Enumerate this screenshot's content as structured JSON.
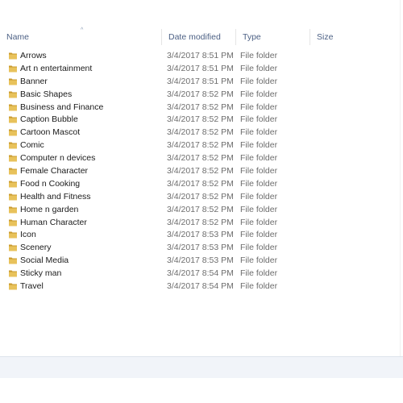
{
  "columns": {
    "name": "Name",
    "date_modified": "Date modified",
    "type": "Type",
    "size": "Size"
  },
  "sort_indicator": "^",
  "folder_icon": "folder-icon",
  "colors": {
    "folder": "#e8c25b",
    "folder_dark": "#c99a2e",
    "header_text": "#4d6185"
  },
  "items": [
    {
      "name": "Arrows",
      "date": "3/4/2017 8:51 PM",
      "type": "File folder"
    },
    {
      "name": "Art n entertainment",
      "date": "3/4/2017 8:51 PM",
      "type": "File folder"
    },
    {
      "name": "Banner",
      "date": "3/4/2017 8:51 PM",
      "type": "File folder"
    },
    {
      "name": "Basic Shapes",
      "date": "3/4/2017 8:52 PM",
      "type": "File folder"
    },
    {
      "name": "Business and Finance",
      "date": "3/4/2017 8:52 PM",
      "type": "File folder"
    },
    {
      "name": "Caption Bubble",
      "date": "3/4/2017 8:52 PM",
      "type": "File folder"
    },
    {
      "name": "Cartoon Mascot",
      "date": "3/4/2017 8:52 PM",
      "type": "File folder"
    },
    {
      "name": "Comic",
      "date": "3/4/2017 8:52 PM",
      "type": "File folder"
    },
    {
      "name": "Computer n devices",
      "date": "3/4/2017 8:52 PM",
      "type": "File folder"
    },
    {
      "name": "Female Character",
      "date": "3/4/2017 8:52 PM",
      "type": "File folder"
    },
    {
      "name": "Food n Cooking",
      "date": "3/4/2017 8:52 PM",
      "type": "File folder"
    },
    {
      "name": "Health and Fitness",
      "date": "3/4/2017 8:52 PM",
      "type": "File folder"
    },
    {
      "name": "Home n garden",
      "date": "3/4/2017 8:52 PM",
      "type": "File folder"
    },
    {
      "name": "Human Character",
      "date": "3/4/2017 8:52 PM",
      "type": "File folder"
    },
    {
      "name": "Icon",
      "date": "3/4/2017 8:53 PM",
      "type": "File folder"
    },
    {
      "name": "Scenery",
      "date": "3/4/2017 8:53 PM",
      "type": "File folder"
    },
    {
      "name": "Social Media",
      "date": "3/4/2017 8:53 PM",
      "type": "File folder"
    },
    {
      "name": "Sticky man",
      "date": "3/4/2017 8:54 PM",
      "type": "File folder"
    },
    {
      "name": "Travel",
      "date": "3/4/2017 8:54 PM",
      "type": "File folder"
    }
  ]
}
